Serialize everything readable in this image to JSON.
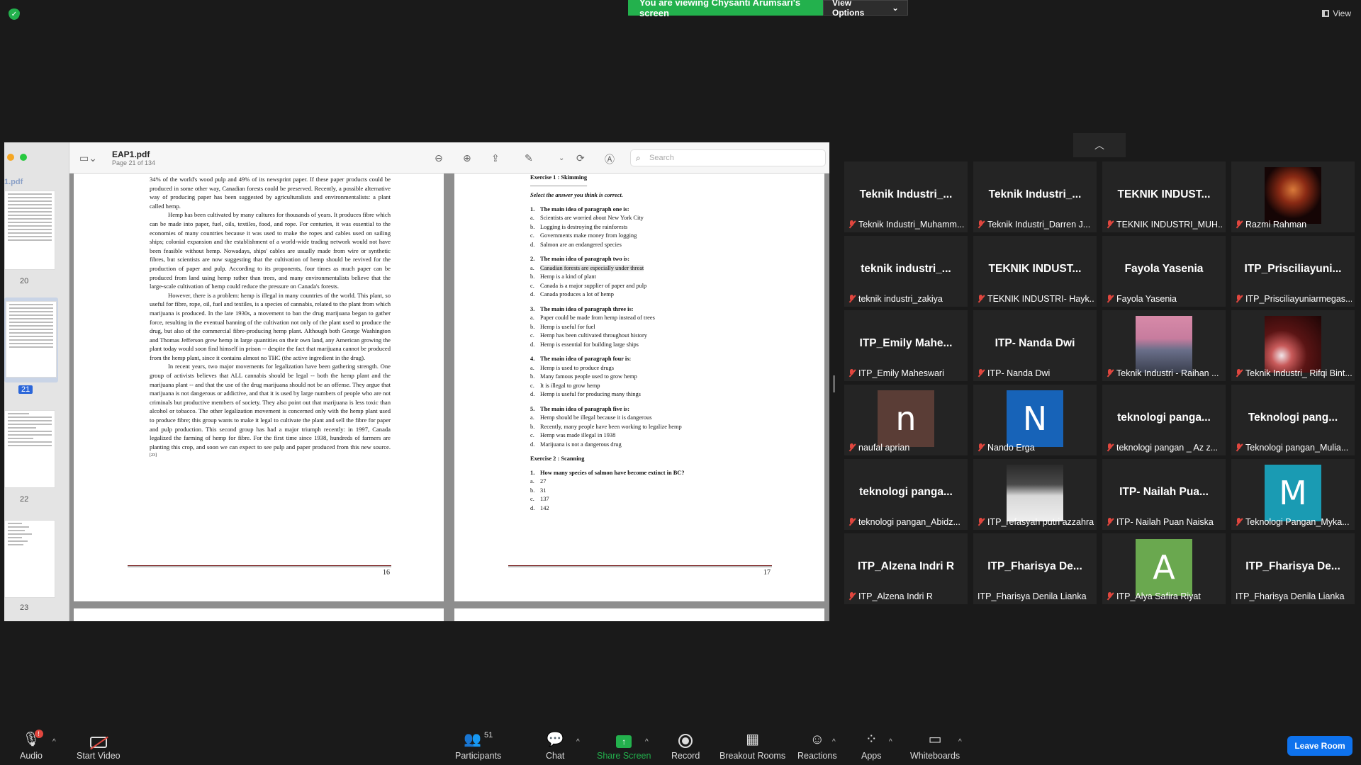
{
  "banner": {
    "viewing_text": "You are viewing Chysanti Arumsari's screen",
    "view_options": "View Options"
  },
  "top_right": {
    "view_label": "View"
  },
  "pdf": {
    "filename": "EAP1.pdf",
    "page_info": "Page 21 of 134",
    "search_placeholder": "Search",
    "sidebar_label": "1.pdf",
    "thumb_numbers": [
      "20",
      "21",
      "22",
      "23"
    ],
    "left_page": {
      "paragraphs": [
        "34% of the world's wood pulp and 49% of its newsprint paper. If these paper products could be produced in some other way, Canadian forests could be preserved. Recently, a possible alternative way of producing paper has been suggested by agriculturalists and environmentalists: a plant called hemp.",
        "Hemp has been cultivated by many cultures for thousands of years. It produces fibre which can be made into paper, fuel, oils, textiles, food, and rope. For centuries, it was essential to the economies of many countries because it was used to make the ropes and cables used on sailing ships; colonial expansion and the establishment of a world-wide trading network would not have been feasible without hemp. Nowadays, ships' cables are usually made from wire or synthetic fibres, but scientists are now suggesting that the cultivation of hemp should be revived for the production of paper and pulp. According to its proponents, four times as much paper can be produced from land using hemp rather than trees, and many environmentalists believe that the large-scale cultivation of hemp could reduce the pressure on Canada's forests.",
        "However, there is a problem: hemp is illegal in many countries of the world. This plant, so useful for fibre, rope, oil, fuel and textiles, is a species of cannabis, related to the plant from which marijuana is produced. In the late 1930s, a movement to ban the drug marijuana began to gather force, resulting in the eventual banning of the cultivation not only of the plant used to produce the drug, but also of the commercial fibre-producing hemp plant. Although both George Washington and Thomas Jefferson grew hemp in large quantities on their own land, any American growing the plant today would soon find himself in prison -- despite the fact that marijuana cannot be produced from the hemp plant, since it contains almost no THC (the active ingredient in the drug).",
        "In recent years, two major movements for legalization have been gathering strength. One group of activists believes that ALL cannabis should be legal -- both the hemp plant and the marijuana plant -- and that the use of the drug marijuana should not be an offense. They argue that marijuana is not dangerous or addictive, and that it is used by large numbers of people who are not criminals but productive members of society. They also point out that marijuana is less toxic than alcohol or tobacco. The other legalization movement is concerned only with the hemp plant used to produce fibre; this group wants to make it legal to cultivate the plant and sell the fibre for paper and pulp production. This second group has had a major triumph recently: in 1997, Canada legalized the farming of hemp for fibre. For the first time since 1938, hundreds of farmers are planting this crop, and soon we can expect to see pulp and paper produced from this new source."
      ],
      "footnote": "[23]",
      "page_number": "16"
    },
    "right_page": {
      "exercise1_title": "Exercise 1 : Skimming",
      "instruction": "Select the answer you think is correct.",
      "questions": [
        {
          "num": "1.",
          "text": "The main idea of paragraph one is:",
          "options": [
            [
              "a.",
              "Scientists are worried about New York City"
            ],
            [
              "b.",
              "Logging is destroying the rainforests"
            ],
            [
              "c.",
              "Governments make money from logging"
            ],
            [
              "d.",
              "Salmon are an endangered species"
            ]
          ]
        },
        {
          "num": "2.",
          "text": "The main idea of paragraph two is:",
          "options": [
            [
              "a.",
              "Canadian forests are especially under threat"
            ],
            [
              "b.",
              "Hemp is a kind of plant"
            ],
            [
              "c.",
              "Canada is a major supplier of paper and pulp"
            ],
            [
              "d.",
              "Canada produces a lot of hemp"
            ]
          ]
        },
        {
          "num": "3.",
          "text": "The main idea of paragraph three is:",
          "options": [
            [
              "a.",
              "Paper could be made from hemp instead of trees"
            ],
            [
              "b.",
              "Hemp is useful for fuel"
            ],
            [
              "c.",
              "Hemp has been cultivated throughout history"
            ],
            [
              "d.",
              "Hemp is essential for building large ships"
            ]
          ]
        },
        {
          "num": "4.",
          "text": "The main idea of paragraph four is:",
          "options": [
            [
              "a.",
              "Hemp is used to produce drugs"
            ],
            [
              "b.",
              "Many famous people used to grow hemp"
            ],
            [
              "c.",
              "It is illegal to grow hemp"
            ],
            [
              "d.",
              "Hemp is useful for producing many things"
            ]
          ]
        },
        {
          "num": "5.",
          "text": "The main idea of paragraph five is:",
          "options": [
            [
              "a.",
              "Hemp should be illegal because it is dangerous"
            ],
            [
              "b.",
              "Recently, many people have been working to legalize hemp"
            ],
            [
              "c.",
              "Hemp was made illegal in 1938"
            ],
            [
              "d.",
              "Marijuana is not a dangerous drug"
            ]
          ]
        }
      ],
      "exercise2_title": "Exercise 2 : Scanning",
      "scan_question": {
        "num": "1.",
        "text": "How many species of salmon have become extinct in BC?",
        "options": [
          [
            "a.",
            "27"
          ],
          [
            "b.",
            "31"
          ],
          [
            "c.",
            "137"
          ],
          [
            "d.",
            "142"
          ]
        ]
      },
      "page_number": "17"
    }
  },
  "participants": [
    {
      "big": "Teknik Industri_...",
      "label": "Teknik Industri_Muhamm...",
      "muted": true
    },
    {
      "big": "Teknik Industri_...",
      "label": "Teknik Industri_Darren J...",
      "muted": true
    },
    {
      "big": "TEKNIK INDUST...",
      "label": "TEKNIK INDUSTRI_MUH...",
      "muted": true
    },
    {
      "big": "",
      "label": "Razmi Rahman",
      "muted": true,
      "avatar": "photo-red"
    },
    {
      "big": "teknik industri_...",
      "label": "teknik industri_zakiya",
      "muted": true
    },
    {
      "big": "TEKNIK INDUST...",
      "label": "TEKNIK INDUSTRI- Hayk...",
      "muted": true
    },
    {
      "big": "Fayola Yasenia",
      "label": "Fayola Yasenia",
      "muted": true
    },
    {
      "big": "ITP_Prisciliayuni...",
      "label": "ITP_Prisciliayuniarmegas...",
      "muted": true
    },
    {
      "big": "ITP_Emily Mahe...",
      "label": "ITP_Emily Maheswari",
      "muted": true
    },
    {
      "big": "ITP- Nanda Dwi",
      "label": "ITP- Nanda Dwi",
      "muted": true
    },
    {
      "big": "",
      "label": "Teknik Industri - Raihan ...",
      "muted": true,
      "avatar": "photo-sky"
    },
    {
      "big": "",
      "label": "Teknik Industri_ Rifqi Bint...",
      "muted": true,
      "avatar": "photo-night"
    },
    {
      "big": "",
      "label": "naufal aprian",
      "muted": true,
      "avatar": "letter",
      "letter": "n",
      "color": "#5a3d36"
    },
    {
      "big": "",
      "label": "Nando Erga",
      "muted": true,
      "avatar": "letter",
      "letter": "N",
      "color": "#1763b8"
    },
    {
      "big": "teknologi panga...",
      "label": "teknologi pangan _ Az z...",
      "muted": true
    },
    {
      "big": "Teknologi pang...",
      "label": "Teknologi pangan_Mulia...",
      "muted": true
    },
    {
      "big": "teknologi panga...",
      "label": "teknologi pangan_Abidz...",
      "muted": true
    },
    {
      "big": "",
      "label": "ITP_refasyah putri azzahra",
      "muted": true,
      "avatar": "photo-bw"
    },
    {
      "big": "ITP- Nailah Pua...",
      "label": "ITP- Nailah Puan Naiska",
      "muted": true
    },
    {
      "big": "",
      "label": "Teknologi Pangan_Myka...",
      "muted": true,
      "avatar": "letter",
      "letter": "M",
      "color": "#1a9bb3"
    },
    {
      "big": "ITP_Alzena Indri R",
      "label": "ITP_Alzena Indri R",
      "muted": true
    },
    {
      "big": "ITP_Fharisya De...",
      "label": "ITP_Fharisya Denila Lianka",
      "muted": false
    },
    {
      "big": "",
      "label": "ITP_Alya Safira Riyat",
      "muted": true,
      "avatar": "letter",
      "letter": "A",
      "color": "#6aa84f"
    },
    {
      "big": "ITP_Fharisya De...",
      "label": "ITP_Fharisya Denila Lianka",
      "muted": false
    }
  ],
  "toolbar": {
    "audio": "Audio",
    "start_video": "Start Video",
    "participants": "Participants",
    "participant_count": "51",
    "chat": "Chat",
    "share_screen": "Share Screen",
    "record": "Record",
    "breakout_rooms": "Breakout Rooms",
    "reactions": "Reactions",
    "apps": "Apps",
    "whiteboards": "Whiteboards",
    "leave": "Leave Room",
    "audio_badge": "!"
  },
  "colors": {
    "share_green": "#23b14d",
    "leave_blue": "#0e72ed",
    "mute_red": "#e0463e"
  }
}
